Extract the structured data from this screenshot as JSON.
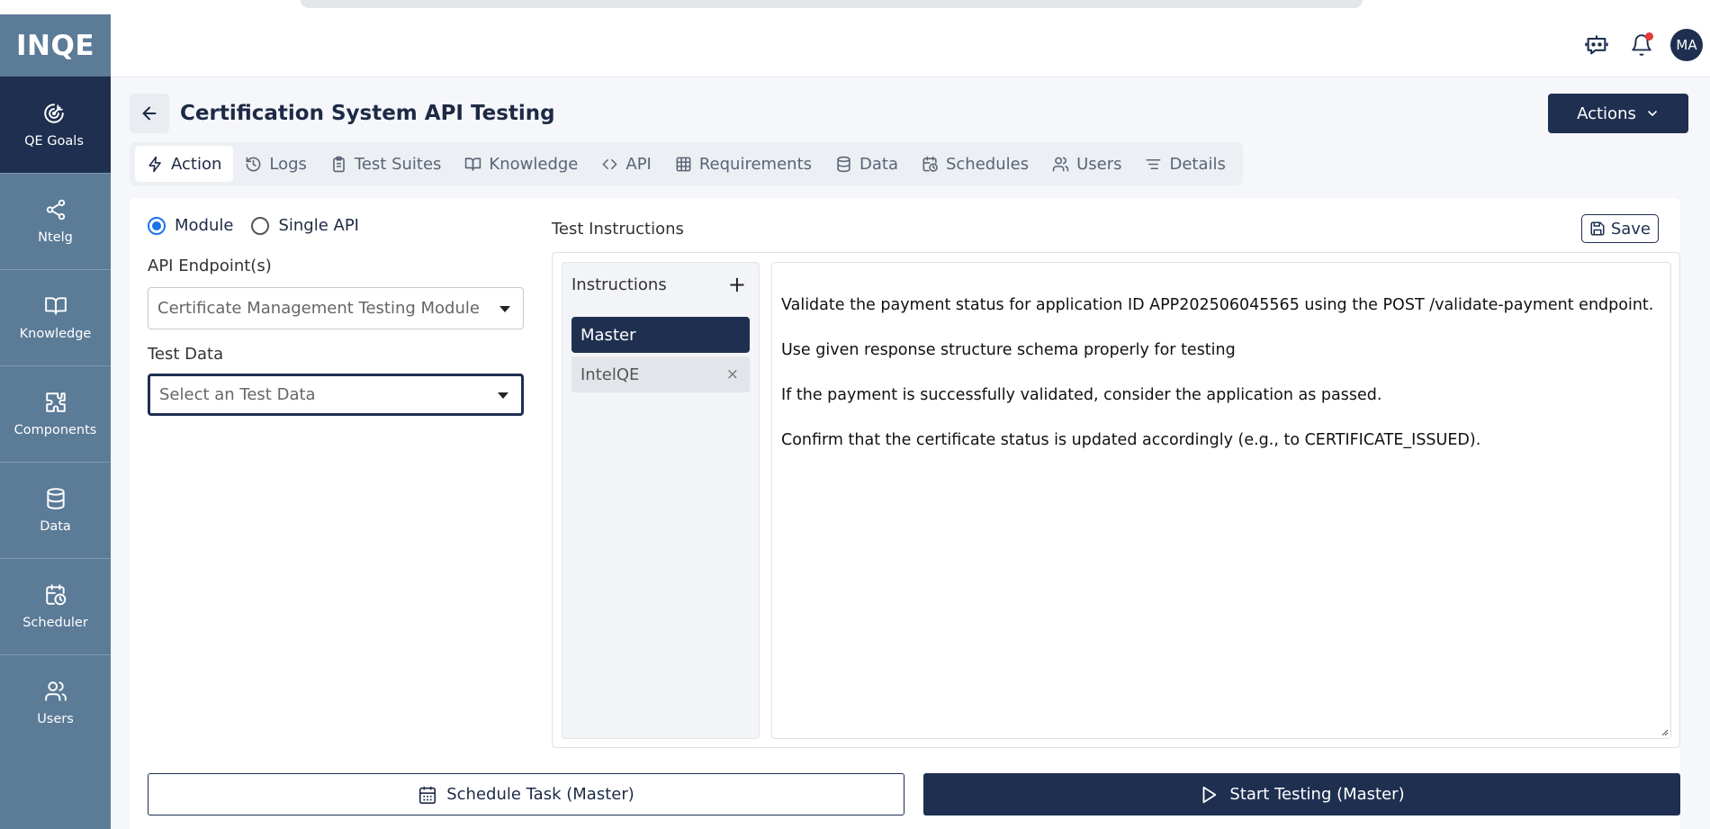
{
  "app": {
    "logo": "INQE"
  },
  "sidebar": {
    "items": [
      {
        "label": "QE Goals",
        "icon": "target-icon",
        "active": true
      },
      {
        "label": "Ntelg",
        "icon": "share-icon"
      },
      {
        "label": "Knowledge",
        "icon": "book-icon"
      },
      {
        "label": "Components",
        "icon": "puzzle-icon"
      },
      {
        "label": "Data",
        "icon": "database-icon"
      },
      {
        "label": "Scheduler",
        "icon": "calendar-clock-icon"
      },
      {
        "label": "Users",
        "icon": "users-icon"
      }
    ]
  },
  "header": {
    "avatar": "MA"
  },
  "page": {
    "title": "Certification System API Testing",
    "actions_label": "Actions"
  },
  "tabs": [
    {
      "label": "Action",
      "icon": "bolt-icon",
      "active": true
    },
    {
      "label": "Logs",
      "icon": "history-icon"
    },
    {
      "label": "Test Suites",
      "icon": "clipboard-icon"
    },
    {
      "label": "Knowledge",
      "icon": "book-open-icon"
    },
    {
      "label": "API",
      "icon": "code-icon"
    },
    {
      "label": "Requirements",
      "icon": "table-icon"
    },
    {
      "label": "Data",
      "icon": "database-icon"
    },
    {
      "label": "Schedules",
      "icon": "calendar-clock-icon"
    },
    {
      "label": "Users",
      "icon": "users-icon"
    },
    {
      "label": "Details",
      "icon": "align-icon"
    }
  ],
  "form": {
    "mode_options": [
      "Module",
      "Single API"
    ],
    "mode_selected": "Module",
    "endpoint_label": "API Endpoint(s)",
    "endpoint_value": "Certificate Management Testing Module",
    "testdata_label": "Test Data",
    "testdata_placeholder": "Select an Test Data"
  },
  "instructions": {
    "section_label": "Test Instructions",
    "save_label": "Save",
    "list_label": "Instructions",
    "add_symbol": "+",
    "items": [
      {
        "label": "Master",
        "active": true
      },
      {
        "label": "IntelQE",
        "removable": true
      }
    ],
    "remove_symbol": "×",
    "text": [
      "Validate the payment status for application ID APP202506045565 using the POST /validate-payment endpoint.",
      "Use given response structure schema properly for testing",
      "If the payment is successfully validated, consider the application as passed.",
      "Confirm that the certificate status is updated accordingly (e.g., to CERTIFICATE_ISSUED)."
    ]
  },
  "footer": {
    "schedule_label": "Schedule Task (Master)",
    "start_label": "Start Testing (Master)"
  },
  "colors": {
    "navy": "#1e2f50",
    "sidebar": "#5b7b97",
    "accent": "#1a73e8",
    "notification": "#e53935"
  }
}
